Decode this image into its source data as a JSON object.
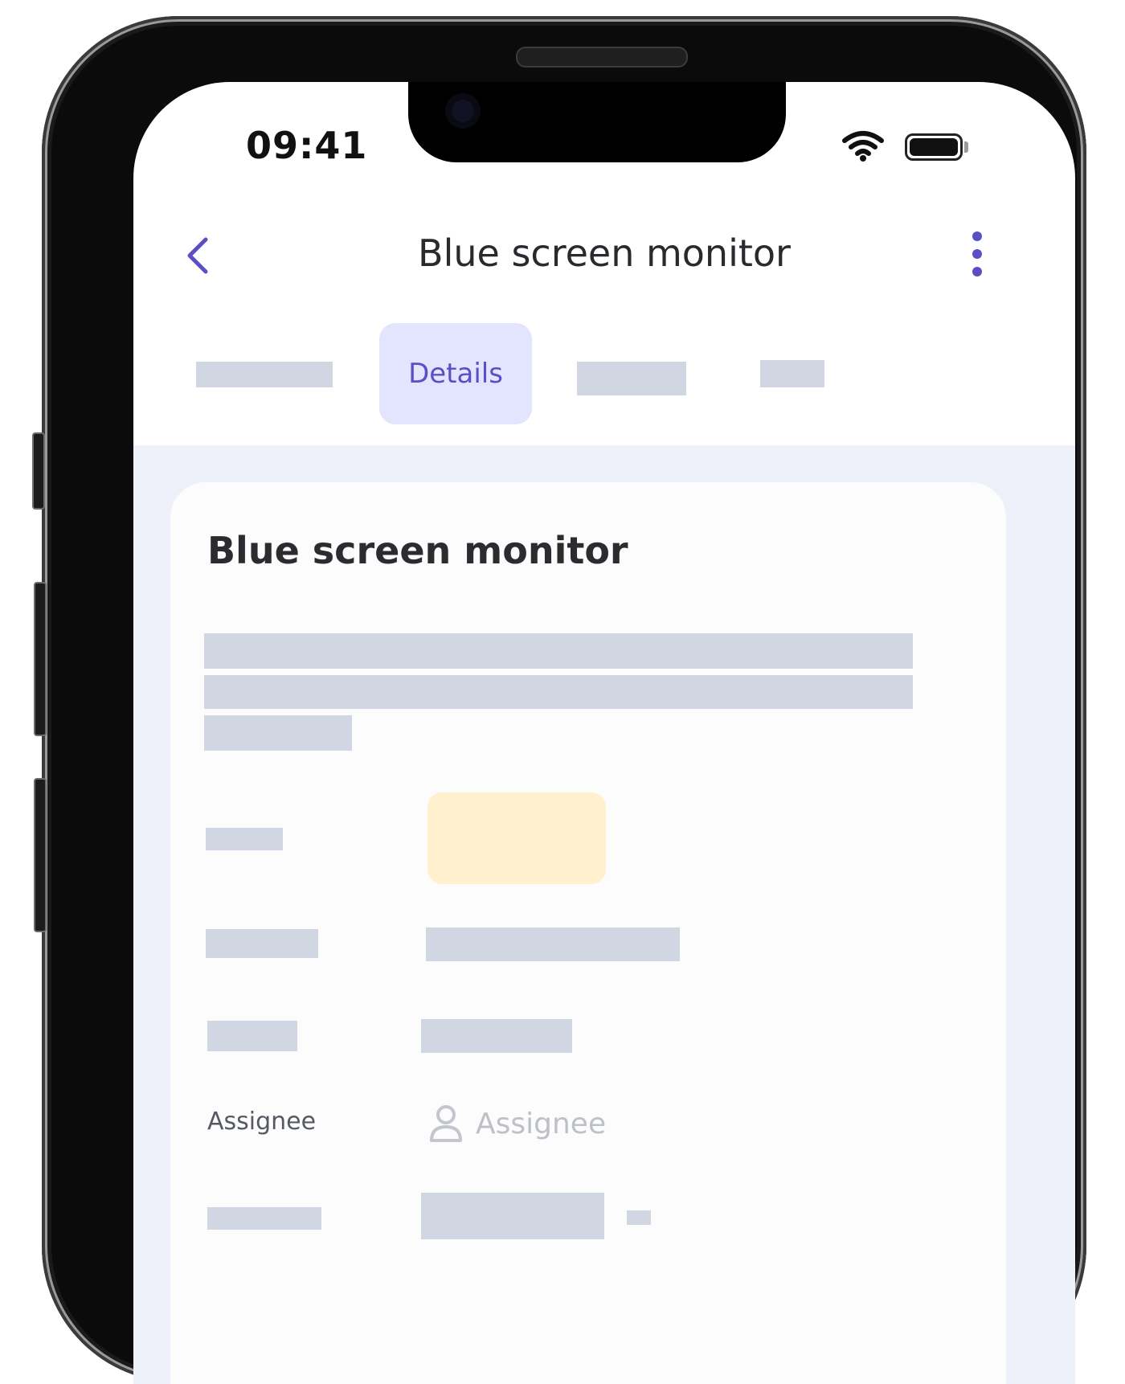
{
  "status_bar": {
    "time": "09:41"
  },
  "nav": {
    "title": "Blue screen monitor",
    "back_icon": "chevron-left-icon",
    "more_icon": "vertical-dots-icon"
  },
  "tabs": {
    "active_label": "Details"
  },
  "card": {
    "title": "Blue screen monitor",
    "assignee_label": "Assignee",
    "assignee_placeholder": "Assignee",
    "assignee_icon": "person-icon"
  },
  "colors": {
    "accent": "#5b4fc6",
    "active_tab_bg": "#e2e5fd",
    "content_bg": "#eef0fa",
    "skeleton": "#d0d7e2",
    "status_chip": "#fff1ce"
  }
}
